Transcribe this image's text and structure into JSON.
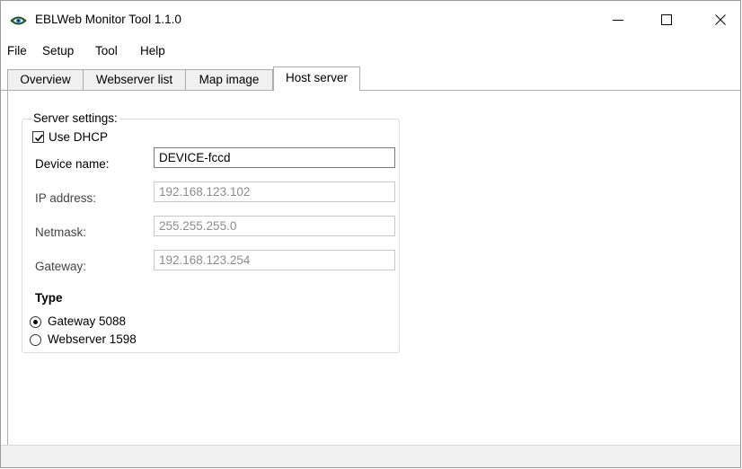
{
  "window": {
    "title": "EBLWeb Monitor Tool 1.1.0",
    "controls": {
      "minimize": "—",
      "maximize": "☐",
      "close": "✕"
    }
  },
  "menu": {
    "items": [
      {
        "label": "File"
      },
      {
        "label": "Setup"
      },
      {
        "label": "Tool"
      },
      {
        "label": "Help"
      }
    ]
  },
  "tabs": {
    "items": [
      {
        "label": "Overview"
      },
      {
        "label": "Webserver list"
      },
      {
        "label": "Map image"
      },
      {
        "label": "Host server"
      }
    ],
    "active": "Host server"
  },
  "server_settings": {
    "group_title": "Server settings:",
    "use_dhcp": {
      "label": "Use DHCP",
      "checked": true
    },
    "device_name": {
      "label": "Device name:",
      "value": "DEVICE-fccd"
    },
    "ip_address": {
      "label": "IP address:",
      "value": "192.168.123.102"
    },
    "netmask": {
      "label": "Netmask:",
      "value": "255.255.255.0"
    },
    "gateway": {
      "label": "Gateway:",
      "value": "192.168.123.254"
    }
  },
  "type": {
    "label": "Type",
    "options": [
      {
        "label": "Gateway 5088",
        "selected": true
      },
      {
        "label": "Webserver 1598",
        "selected": false
      }
    ]
  },
  "icons": {
    "app": "eye-icon"
  }
}
